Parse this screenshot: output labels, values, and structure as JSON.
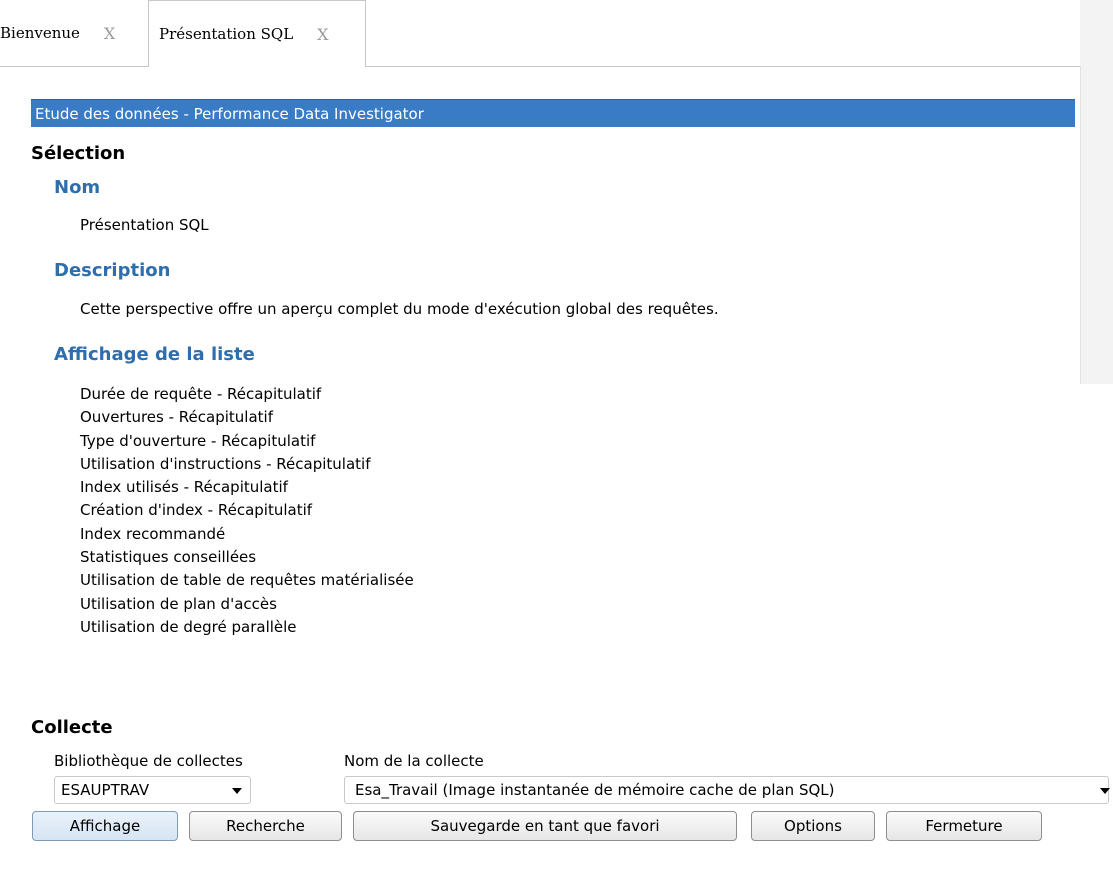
{
  "tabs": [
    {
      "label": "Bienvenue",
      "close": "X"
    },
    {
      "label": "Présentation SQL",
      "close": "X"
    }
  ],
  "panel": {
    "title": "Etude des données - Performance Data Investigator"
  },
  "selection": {
    "heading": "Sélection",
    "name_label": "Nom",
    "name_value": "Présentation SQL",
    "description_label": "Description",
    "description_value": "Cette perspective offre un aperçu complet du mode d'exécution global des requêtes.",
    "list_label": "Affichage de la liste",
    "list_items": [
      "Durée de requête - Récapitulatif",
      "Ouvertures - Récapitulatif",
      "Type d'ouverture - Récapitulatif",
      "Utilisation d'instructions - Récapitulatif",
      "Index utilisés - Récapitulatif",
      "Création d'index - Récapitulatif",
      "Index recommandé",
      "Statistiques conseillées",
      "Utilisation de table de requêtes matérialisée",
      "Utilisation de plan d'accès",
      "Utilisation de degré parallèle"
    ]
  },
  "collection": {
    "heading": "Collecte",
    "library_label": "Bibliothèque de collectes",
    "library_value": "ESAUPTRAV",
    "name_label": "Nom de la collecte",
    "name_value": "Esa_Travail (Image instantanée de mémoire cache de plan SQL)"
  },
  "buttons": {
    "display": "Affichage",
    "search": "Recherche",
    "save_favorite": "Sauvegarde en tant que favori",
    "options": "Options",
    "close": "Fermeture"
  },
  "colors": {
    "header_bg": "#3a7bc5",
    "subheading": "#2f6ead"
  }
}
